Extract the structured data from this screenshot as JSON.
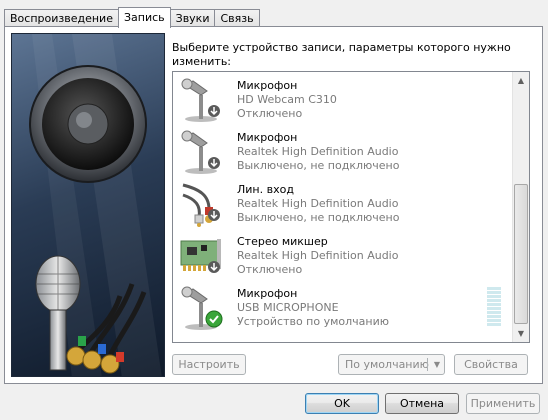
{
  "tabs": [
    {
      "label": "Воспроизведение",
      "active": false
    },
    {
      "label": "Запись",
      "active": true
    },
    {
      "label": "Звуки",
      "active": false
    },
    {
      "label": "Связь",
      "active": false
    }
  ],
  "instruction": "Выберите устройство записи, параметры которого нужно изменить:",
  "devices": [
    {
      "name": "Микрофон",
      "driver": "HD Webcam C310",
      "status": "Отключено",
      "icon": "microphone-icon",
      "badge": "down-arrow-icon"
    },
    {
      "name": "Микрофон",
      "driver": "Realtek High Definition Audio",
      "status": "Выключено, не подключено",
      "icon": "microphone-icon",
      "badge": "down-arrow-icon"
    },
    {
      "name": "Лин. вход",
      "driver": "Realtek High Definition Audio",
      "status": "Выключено, не подключено",
      "icon": "line-in-cable-icon",
      "badge": "down-arrow-icon"
    },
    {
      "name": "Стерео микшер",
      "driver": "Realtek High Definition Audio",
      "status": "Отключено",
      "icon": "sound-card-icon",
      "badge": "down-arrow-icon"
    },
    {
      "name": "Микрофон",
      "driver": "USB MICROPHONE",
      "status": "Устройство по умолчанию",
      "icon": "microphone-icon",
      "badge": "default-check-icon"
    }
  ],
  "buttons": {
    "configure": "Настроить",
    "set_default": "По умолчанию",
    "properties": "Свойства",
    "ok": "OK",
    "cancel": "Отмена",
    "apply": "Применить"
  },
  "colors": {
    "check_green": "#3aa63a",
    "level_meter": "#cfe9ee"
  }
}
